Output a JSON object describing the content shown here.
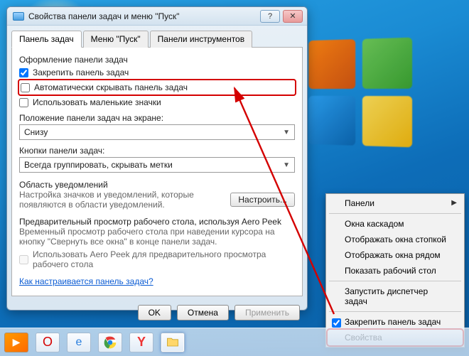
{
  "window": {
    "title": "Свойства панели задач и меню \"Пуск\"",
    "tabs": [
      "Панель задач",
      "Меню \"Пуск\"",
      "Панели инструментов"
    ],
    "group_header": "Оформление панели задач",
    "lock_label": "Закрепить панель задач",
    "autohide_label": "Автоматически скрывать панель задач",
    "smallicons_label": "Использовать маленькие значки",
    "position_label": "Положение панели задач на экране:",
    "position_value": "Снизу",
    "buttons_label": "Кнопки панели задач:",
    "buttons_value": "Всегда группировать, скрывать метки",
    "notif_header": "Область уведомлений",
    "notif_desc": "Настройка значков и уведомлений, которые появляются в области уведомлений.",
    "notif_btn": "Настроить...",
    "peek_header": "Предварительный просмотр рабочего стола, используя Aero Peek",
    "peek_desc": "Временный просмотр рабочего стола при наведении курсора на кнопку \"Свернуть все окна\" в конце панели задач.",
    "peek_chk": "Использовать Aero Peek для предварительного просмотра рабочего стола",
    "help_link": "Как настраивается панель задач?",
    "ok": "OK",
    "cancel": "Отмена",
    "apply": "Применить"
  },
  "context_menu": {
    "items": [
      "Панели",
      "Окна каскадом",
      "Отображать окна стопкой",
      "Отображать окна рядом",
      "Показать рабочий стол",
      "Запустить диспетчер задач",
      "Закрепить панель задач",
      "Свойства"
    ]
  }
}
